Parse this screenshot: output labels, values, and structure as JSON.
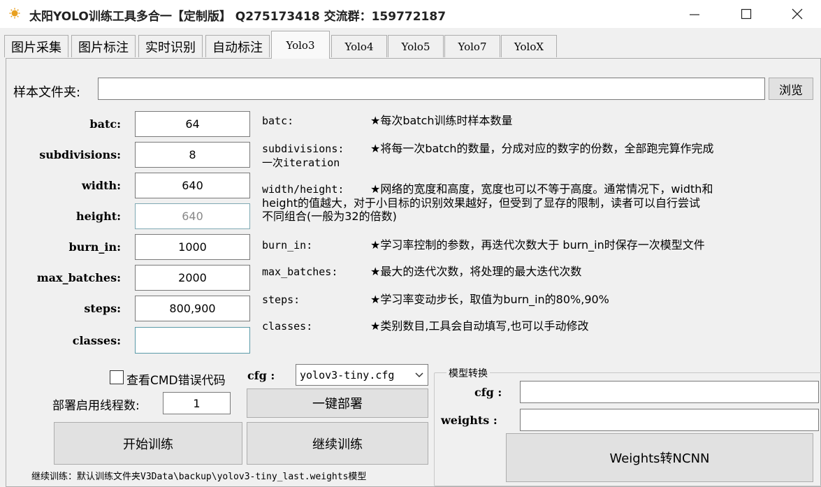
{
  "window": {
    "title": "太阳YOLO训练工具多合一【定制版】 Q275173418 交流群：159772187"
  },
  "tabs": [
    {
      "label": "图片采集"
    },
    {
      "label": "图片标注"
    },
    {
      "label": "实时识别"
    },
    {
      "label": "自动标注"
    },
    {
      "label": "Yolo3"
    },
    {
      "label": "Yolo4"
    },
    {
      "label": "Yolo5"
    },
    {
      "label": "Yolo7"
    },
    {
      "label": "YoloX"
    }
  ],
  "sample_folder": {
    "label": "样本文件夹:",
    "value": "",
    "browse_label": "浏览"
  },
  "params": [
    {
      "label": "batc:",
      "value": "64",
      "desc_key": "batc:",
      "desc": "★每次batch训练时样本数量"
    },
    {
      "label": "subdivisions:",
      "value": "8",
      "desc_key": "subdivisions:",
      "desc": "★将每一次batch的数量，分成对应的数字的份数，全部跑完算作完成",
      "desc_cont": "一次iteration"
    },
    {
      "label": "width:",
      "value": "640",
      "desc_key": "width/height:",
      "desc": "★网络的宽度和高度，宽度也可以不等于高度。通常情况下，width和",
      "desc_cont": "height的值越大，对于小目标的识别效果越好，但受到了显存的限制，读者可以自行尝试",
      "desc_cont2": "不同组合(一般为32的倍数)"
    },
    {
      "label": "height:",
      "value": "640"
    },
    {
      "label": "burn_in:",
      "value": "1000",
      "desc_key": "burn_in:",
      "desc": "★学习率控制的参数，再迭代次数大于 burn_in时保存一次模型文件"
    },
    {
      "label": "max_batches:",
      "value": "2000",
      "desc_key": "max_batches:",
      "desc": "★最大的迭代次数，将处理的最大迭代次数"
    },
    {
      "label": "steps:",
      "value": "800,900",
      "desc_key": "steps:",
      "desc": "★学习率变动步长，取值为burn_in的80%,90%"
    },
    {
      "label": "classes:",
      "value": "",
      "desc_key": "classes:",
      "desc": "★类别数目,工具会自动填写,也可以手动修改"
    }
  ],
  "bottom": {
    "cmd_checkbox_label": "查看CMD错误代码",
    "threads_label": "部署启用线程数:",
    "threads_value": "1",
    "cfg_label": "cfg :",
    "cfg_selected": "yolov3-tiny.cfg",
    "deploy_button": "一键部署",
    "start_train_button": "开始训练",
    "continue_train_button": "继续训练",
    "hint": "继续训练：默认训练文件夹V3Data\\backup\\yolov3-tiny_last.weights模型"
  },
  "convert_group": {
    "title": "模型转换",
    "cfg_label": "cfg :",
    "cfg_value": "",
    "weights_label": "weights :",
    "weights_value": "",
    "convert_button": "Weights转NCNN"
  },
  "colors": {
    "accent_icon": "#e8a020",
    "focus_border": "#5a9aa8"
  }
}
